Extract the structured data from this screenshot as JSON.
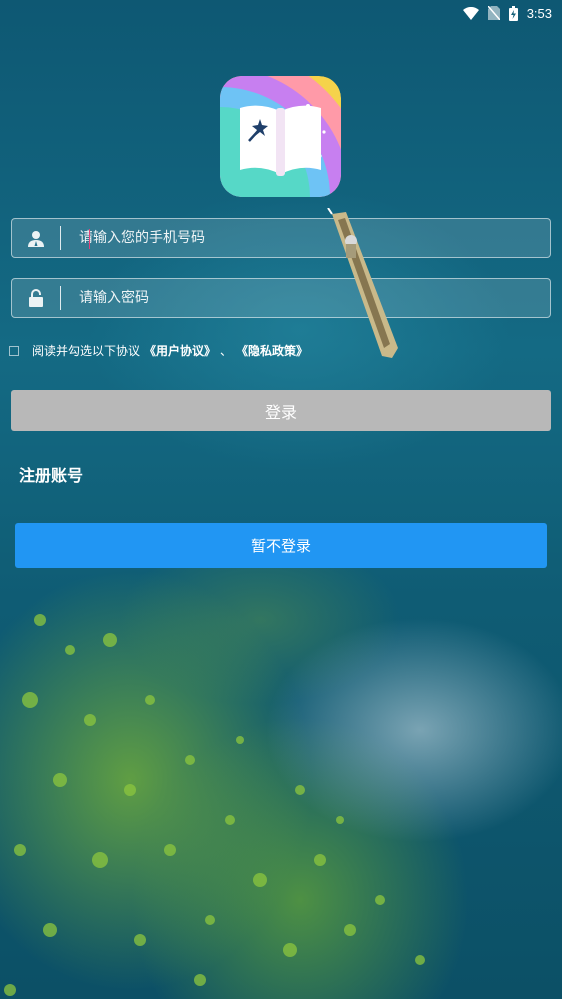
{
  "status_bar": {
    "time": "3:53",
    "icons": [
      "wifi-icon",
      "no-sim-icon",
      "battery-charging-icon"
    ]
  },
  "logo": {
    "icon": "magic-book-icon"
  },
  "phone_field": {
    "placeholder": "请输入您的手机号码",
    "icon": "user-icon"
  },
  "password_field": {
    "placeholder": "请输入密码",
    "icon": "lock-icon"
  },
  "agreement": {
    "text": "阅读并勾选以下协议",
    "user_agreement": "《用户协议》",
    "separator": "、",
    "privacy_policy": "《隐私政策》"
  },
  "login_button": "登录",
  "register_link": "注册账号",
  "skip_login_button": "暂不登录",
  "colors": {
    "primary": "#2196f3",
    "login_disabled": "#b8b8b8"
  }
}
